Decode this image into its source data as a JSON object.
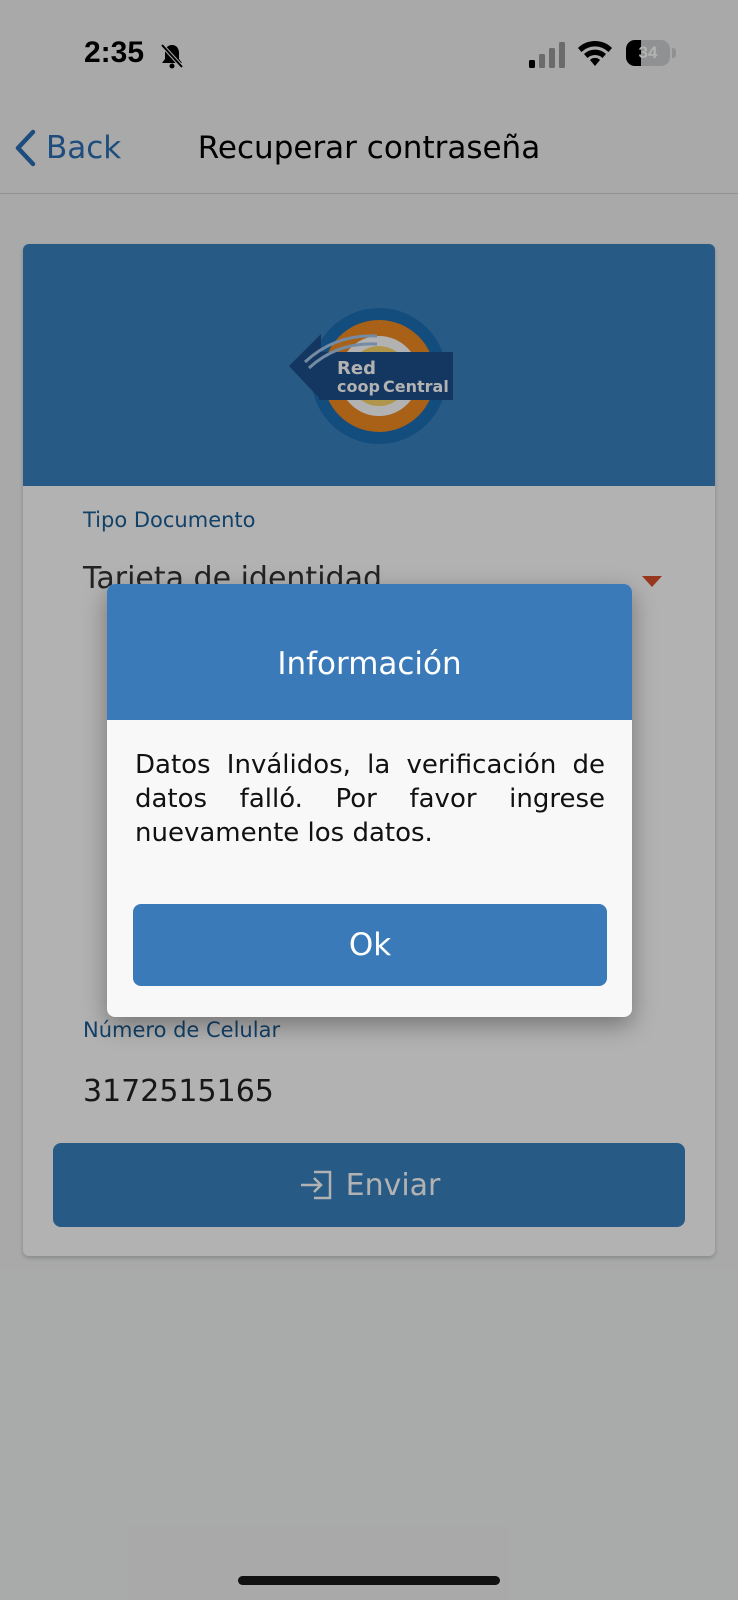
{
  "status_bar": {
    "time": "2:35",
    "battery_level": "34",
    "battery_fraction": 0.34,
    "icons": [
      "bell-slash-icon",
      "cellular-signal-icon",
      "wifi-icon",
      "battery-icon"
    ]
  },
  "nav": {
    "back_label": "Back",
    "title": "Recuperar contraseña"
  },
  "logo": {
    "line1": "Red",
    "line2": "coop",
    "line3": "Central"
  },
  "form": {
    "tipo_documento_label": "Tipo Documento",
    "tipo_documento_value": "Tarjeta de identidad",
    "numero_celular_label": "Número de Celular",
    "numero_celular_value": "3172515165",
    "send_label": "Enviar"
  },
  "dialog": {
    "title": "Información",
    "message": "Datos Inválidos, la verificación de datos falló. Por favor ingrese nuevamente los datos.",
    "ok_label": "Ok"
  },
  "colors": {
    "primary": "#3a82c0",
    "dialog_header": "#3a7ab9",
    "label": "#1a5d96",
    "accent_arrow": "#d94f2b",
    "back_link": "#2b6fb3"
  }
}
